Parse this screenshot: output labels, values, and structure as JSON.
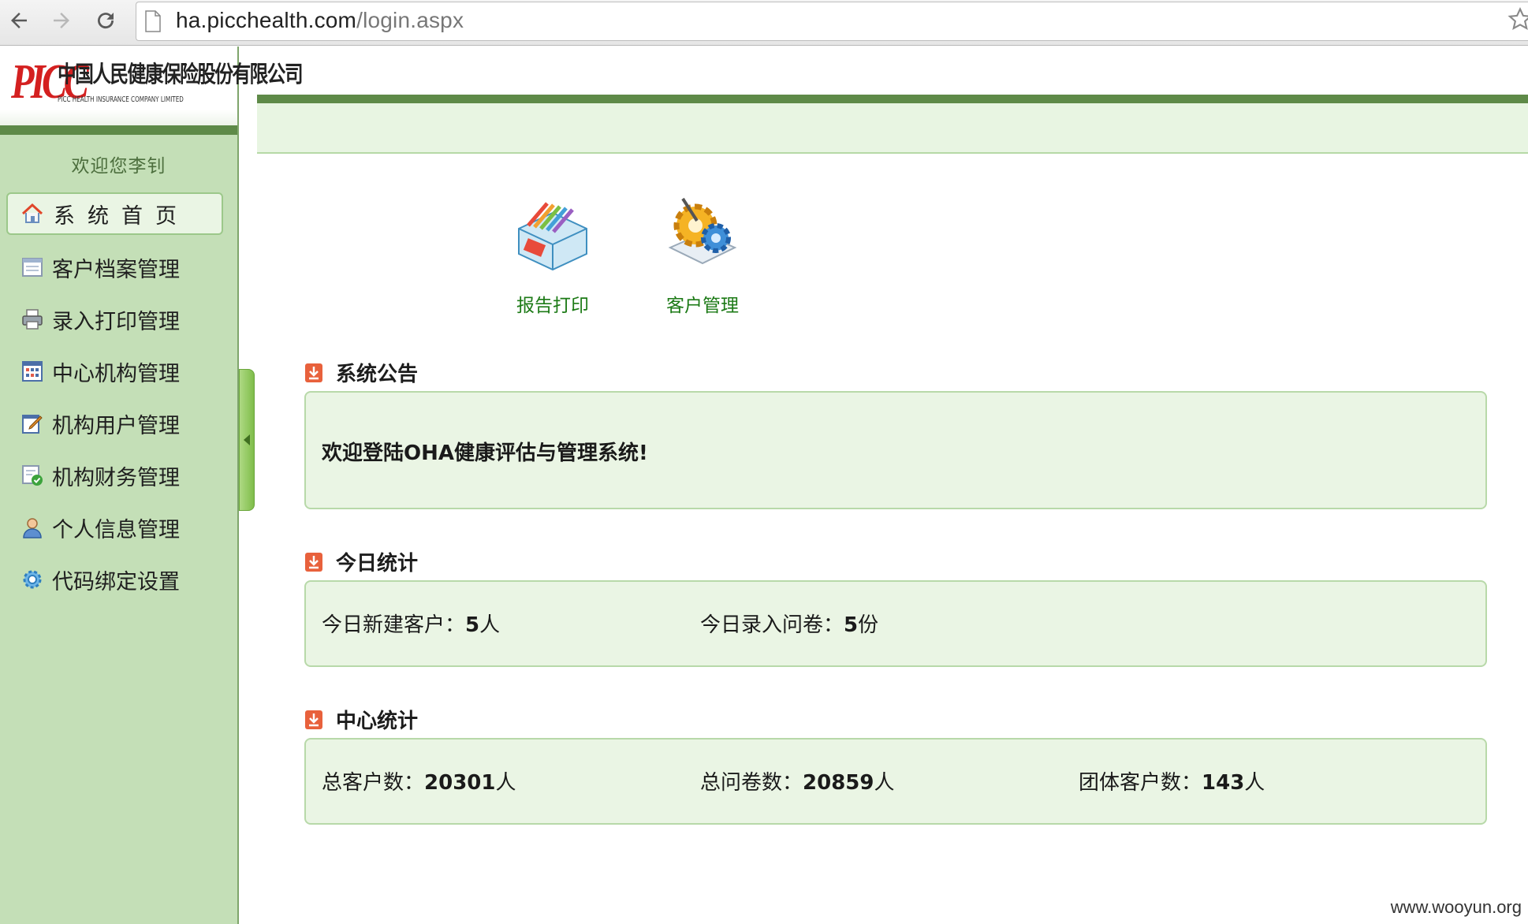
{
  "browser": {
    "url_host": "ha.picchealth.com",
    "url_path": "/login.aspx"
  },
  "logo": {
    "mark": "PICC",
    "company_cn": "中国人民健康保险股份有限公司",
    "company_en": "PICC HEALTH INSURANCE COMPANY LIMITED"
  },
  "sidebar": {
    "welcome": "欢迎您李钊",
    "items": [
      {
        "label": "系统首页",
        "icon": "home-icon",
        "active": true
      },
      {
        "label": "客户档案管理",
        "icon": "file-icon"
      },
      {
        "label": "录入打印管理",
        "icon": "printer-icon"
      },
      {
        "label": "中心机构管理",
        "icon": "grid-icon"
      },
      {
        "label": "机构用户管理",
        "icon": "edit-icon"
      },
      {
        "label": "机构财务管理",
        "icon": "finance-icon"
      },
      {
        "label": "个人信息管理",
        "icon": "user-icon"
      },
      {
        "label": "代码绑定设置",
        "icon": "settings-icon"
      }
    ]
  },
  "quick_links": [
    {
      "label": "报告打印",
      "icon": "report-print-icon"
    },
    {
      "label": "客户管理",
      "icon": "customer-manage-icon"
    }
  ],
  "announcement": {
    "title": "系统公告",
    "text": "欢迎登陆OHA健康评估与管理系统!"
  },
  "today_stats": {
    "title": "今日统计",
    "new_customers_label": "今日新建客户：",
    "new_customers_value": "5",
    "new_customers_unit": "人",
    "questionnaires_label": "今日录入问卷：",
    "questionnaires_value": "5",
    "questionnaires_unit": "份"
  },
  "center_stats": {
    "title": "中心统计",
    "total_customers_label": "总客户数：",
    "total_customers_value": "20301",
    "total_customers_unit": "人",
    "total_questionnaires_label": "总问卷数：",
    "total_questionnaires_value": "20859",
    "total_questionnaires_unit": "人",
    "group_customers_label": "团体客户数：",
    "group_customers_value": "143",
    "group_customers_unit": "人"
  },
  "watermark": "www.wooyun.org"
}
